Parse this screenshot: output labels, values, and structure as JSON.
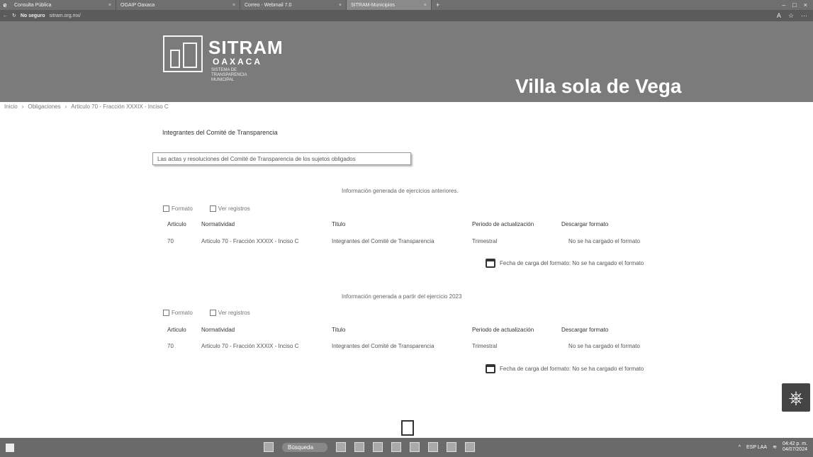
{
  "browser": {
    "tabs": [
      {
        "label": "Consulta Pública",
        "active": false
      },
      {
        "label": "OGAIP Oaxaca",
        "active": false
      },
      {
        "label": "Correo - Webmail 7.0",
        "active": false
      },
      {
        "label": "SITRAM-Municipios",
        "active": true
      }
    ],
    "address": {
      "security_label": "No seguro",
      "url": "sitram.org.mx/"
    }
  },
  "site": {
    "logo_title": "SITRAM",
    "logo_subtitle": "OAXACA",
    "logo_tagline": "SISTEMA DE TRANSPARENCIA MUNICIPAL",
    "municipality": "Villa sola de Vega"
  },
  "breadcrumb": [
    "Inicio",
    "Obligaciones",
    "Articulo 70 - Fracción XXXIX - Inciso C"
  ],
  "content": {
    "section_title": "Integrantes del Comité de Transparencia",
    "select_value": "Las actas y resoluciones del Comité de Transparencia de los sujetos obligados",
    "previous_block": {
      "heading": "Información generada de ejercicios anteriores.",
      "tools": [
        "Formato",
        "Ver registros"
      ],
      "headers": [
        "Articulo",
        "Normatividad",
        "Titulo",
        "Periodo de actualización",
        "Descargar formato"
      ],
      "row": {
        "articulo": "70",
        "normatividad": "Articulo 70 - Fracción XXXIX - Inciso C",
        "titulo": "Integrantes del Comité de Transparencia",
        "periodo": "Trimestral",
        "descarga": "No se ha cargado el formato"
      },
      "upload_note": "Fecha de carga del formato: No se ha cargado el formato"
    },
    "current_block": {
      "heading": "Información generada a partir del ejercicio 2023",
      "tools": [
        "Formato",
        "Ver registros"
      ],
      "headers": [
        "Articulo",
        "Normatividad",
        "Titulo",
        "Periodo de actualización",
        "Descargar formato"
      ],
      "row": {
        "articulo": "70",
        "normatividad": "Articulo 70 - Fracción XXXIX - Inciso C",
        "titulo": "Integrantes del Comité de Transparencia",
        "periodo": "Trimestral",
        "descarga": "No se ha cargado el formato"
      },
      "upload_note": "Fecha de carga del formato: No se ha cargado el formato"
    }
  },
  "taskbar": {
    "search_label": "Búsqueda",
    "lang": "ESP LAA",
    "time": "04:42 p. m.",
    "date": "04/07/2024"
  }
}
